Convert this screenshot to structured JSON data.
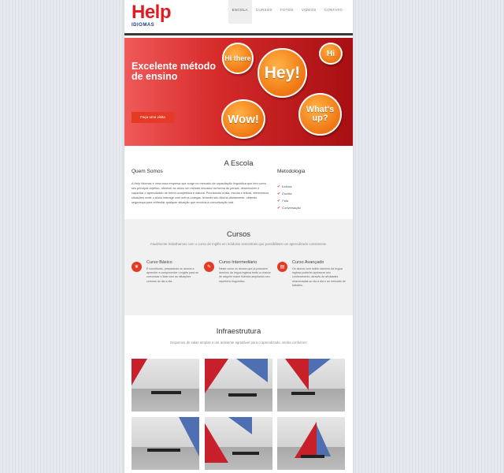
{
  "logo": {
    "main": "Help",
    "sub": "IDIOMAS"
  },
  "nav": [
    "ESCOLA",
    "CURSOS",
    "FOTOS",
    "VIDEOS",
    "CONTATO"
  ],
  "hero": {
    "title": "Excelente método de ensino",
    "button": "Faça uma visita",
    "bubbles": [
      "Hi there",
      "Hey!",
      "Hi",
      "Wow!",
      "What's up?"
    ]
  },
  "escola": {
    "title": "A Escola",
    "quem_title": "Quem Somos",
    "quem_text": "A Help Idiomas é uma nova empresa que surge no mercado de capacitação linguística que tem como seu principal objetivo, oferecer ao aluno um método inovador na forma de pensar, desenvolver e capacitar o aprendizado de forma competitiva e natural. Priorizando a fala, escuta e leitura, oferecemos situações onde o aluno interage com outros colegas, levando seu idioma diariamente, obtendo segurança para enfrentar qualquer situação que envolva a comunicação oral.",
    "met_title": "Metodologia",
    "met_items": [
      "Leitura",
      "Escrita",
      "Fala",
      "Conversação"
    ]
  },
  "cursos": {
    "title": "Cursos",
    "subtitle": "Atualmente trabalhamos com o curso de Inglês em módulos semestrais que possibilitam um aprendizado consistente.",
    "items": [
      {
        "title": "Curso Básico",
        "text": "É constituído, preparando os alunos a aprender a compreender o inglês para se comunicar e lidar com as situações comuns do dia a dia."
      },
      {
        "title": "Curso Intermediário",
        "text": "Neste curso os alunos que já possuem domínio da língua inglesa terão a chance de adquirir maior fluência ampliando seu repertório linguístico."
      },
      {
        "title": "Curso Avançado",
        "text": "Os alunos com sólido domínio da língua inglesa poderão aprimorar seu conhecimento, através de atividades relacionadas ao dia a dia e ao mercado de trabalho."
      }
    ]
  },
  "infra": {
    "title": "Infraestrutura",
    "subtitle": "Dispomos de salas amplas e um ambiente agradável para o aprendizado, venha conhecer!"
  },
  "colors": {
    "brand_red": "#e21b22",
    "brand_blue": "#1d3a8a",
    "accent": "#e53a24",
    "bubble": "#f07712"
  },
  "icons": [
    "check-icon",
    "leaf-icon",
    "pencil-icon",
    "book-icon"
  ]
}
